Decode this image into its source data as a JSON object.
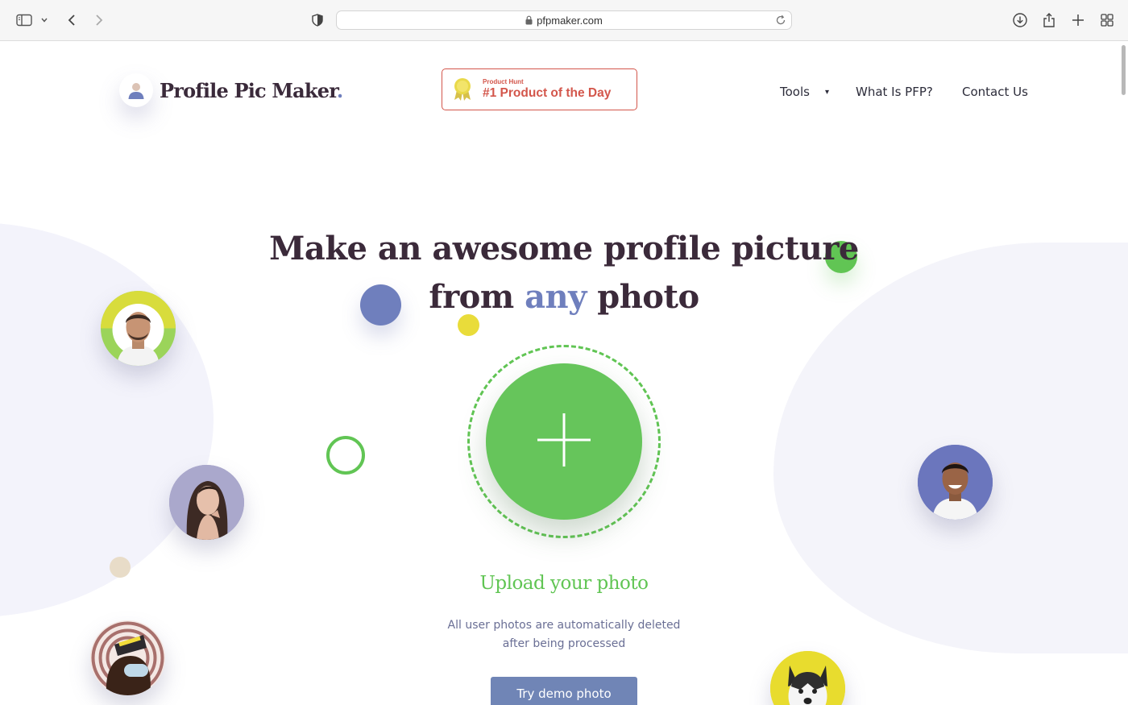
{
  "browser": {
    "url": "pfpmaker.com",
    "icons": [
      "sidebar-icon",
      "chevron-down-icon",
      "back-icon",
      "forward-icon",
      "shield-icon",
      "lock-icon",
      "reload-icon",
      "download-icon",
      "share-icon",
      "new-tab-icon",
      "tab-overview-icon"
    ]
  },
  "header": {
    "logo_text": "Profile Pic Maker",
    "logo_dot": ".",
    "badge": {
      "small": "Product Hunt",
      "big": "#1 Product of the Day"
    },
    "nav": {
      "tools": "Tools",
      "tools_caret": "▾",
      "what_is_pfp": "What Is PFP?",
      "contact": "Contact Us"
    }
  },
  "hero": {
    "line1": "Make an awesome profile picture",
    "line2_before": "from ",
    "line2_accent": "any",
    "line2_after": " photo"
  },
  "upload": {
    "title": "Upload your photo",
    "note_line1": "All user photos are automatically deleted",
    "note_line2": "after being processed",
    "demo_button": "Try demo photo"
  },
  "colors": {
    "green": "#61c554",
    "blue_accent": "#6f7fbd",
    "yellow": "#e9dc3a",
    "badge_red": "#d3564b",
    "heading": "#3b2a3a"
  }
}
